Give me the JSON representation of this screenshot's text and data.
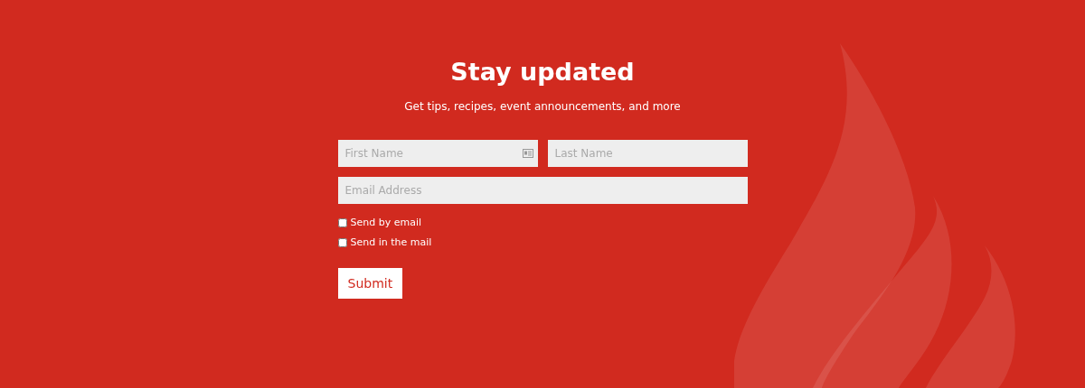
{
  "heading": "Stay updated",
  "subheading": "Get tips, recipes, event announcements, and more",
  "fields": [
    {
      "placeholder": "First Name",
      "kind": "contact"
    },
    {
      "placeholder": "Last Name",
      "kind": "plain"
    },
    {
      "placeholder": "Email Address",
      "kind": "wide"
    }
  ],
  "options": [
    {
      "label": "Send by email",
      "checked": false
    },
    {
      "label": "Send in the mail",
      "checked": false
    }
  ],
  "submit": "Submit"
}
